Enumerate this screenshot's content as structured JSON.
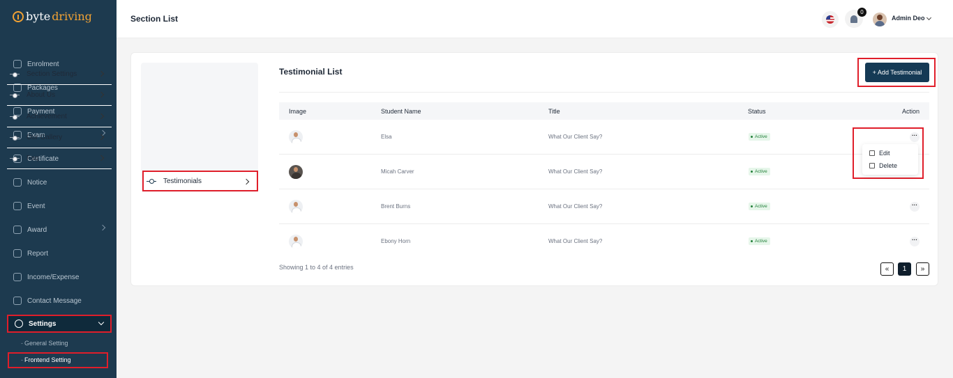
{
  "brand": {
    "part1": "byte",
    "part2": "driving"
  },
  "sidebar": {
    "items": [
      {
        "label": "Enrolment",
        "icon": "enrolment-icon",
        "caret": false
      },
      {
        "label": "Packages",
        "icon": "packages-icon",
        "caret": false
      },
      {
        "label": "Payment",
        "icon": "payment-icon",
        "caret": false
      },
      {
        "label": "Exam",
        "icon": "exam-icon",
        "caret": true
      },
      {
        "label": "Certificate",
        "icon": "certificate-icon",
        "caret": false
      },
      {
        "label": "Notice",
        "icon": "notice-icon",
        "caret": false
      },
      {
        "label": "Event",
        "icon": "event-icon",
        "caret": false
      },
      {
        "label": "Award",
        "icon": "award-icon",
        "caret": true
      },
      {
        "label": "Report",
        "icon": "report-icon",
        "caret": false
      },
      {
        "label": "Income/Expense",
        "icon": "income-expense-icon",
        "caret": false
      },
      {
        "label": "Contact Message",
        "icon": "contact-message-icon",
        "caret": false
      },
      {
        "label": "Settings",
        "icon": "settings-icon",
        "caret": true
      }
    ],
    "settings_sub": [
      "General Setting",
      "Frontend Setting"
    ]
  },
  "header": {
    "title": "Section List",
    "notification_count": "0",
    "user_name": "Admin Deo"
  },
  "section_menu": {
    "items": [
      "Section Settings",
      "About Us",
      "Achievement",
      "Our Gallery",
      "Faq",
      "Testimonials"
    ],
    "active_index": 5
  },
  "testimonials": {
    "title": "Testimonial List",
    "add_button": "+ Add Testimonial",
    "columns": [
      "Image",
      "Student Name",
      "Title",
      "Status",
      "Action"
    ],
    "rows": [
      {
        "name": "Elsa",
        "title": "What Our Client Say?",
        "status": "Active"
      },
      {
        "name": "Micah Carver",
        "title": "What Our Client Say?",
        "status": "Active"
      },
      {
        "name": "Brent Burns",
        "title": "What Our Client Say?",
        "status": "Active"
      },
      {
        "name": "Ebony Horn",
        "title": "What Our Client Say?",
        "status": "Active"
      }
    ],
    "action_glyph": "···",
    "dropdown": {
      "edit": "Edit",
      "delete": "Delete"
    },
    "showing_text": "Showing 1 to 4 of 4 entries",
    "pagination": {
      "prev": "«",
      "current": "1",
      "next": "»"
    }
  },
  "colors": {
    "sidebar_bg": "#1d3a4f",
    "accent": "#f1a234",
    "primary_button": "#153a55",
    "highlight": "#e01e2a",
    "status_green": "#24813b"
  }
}
